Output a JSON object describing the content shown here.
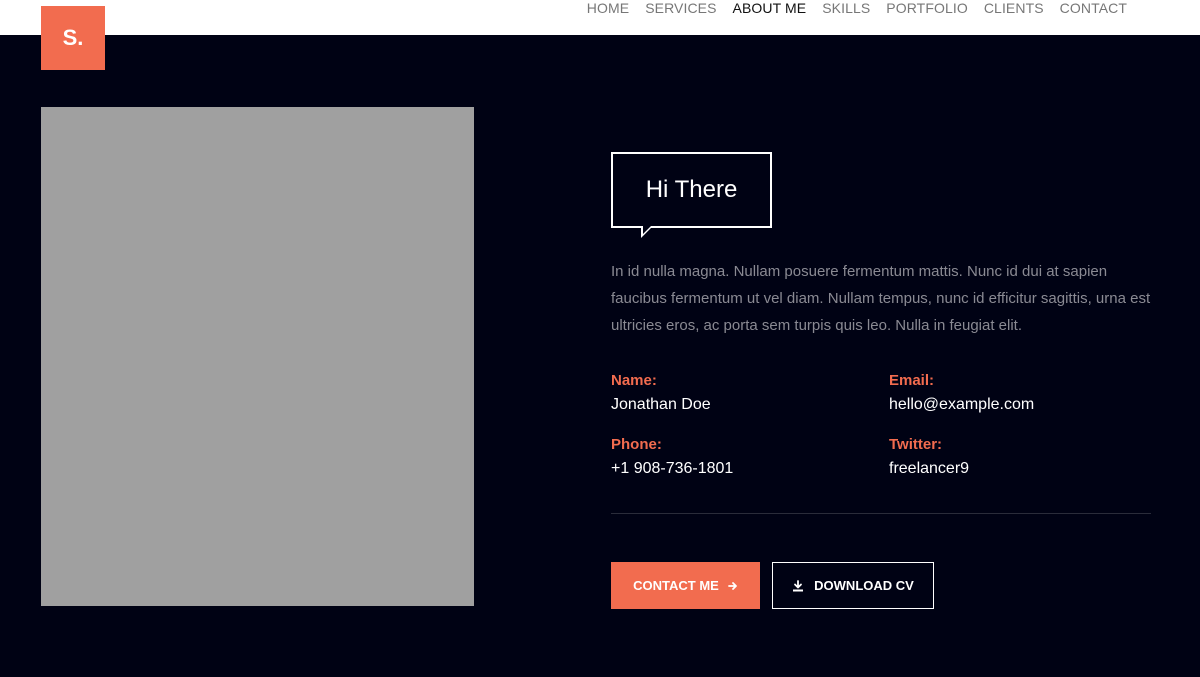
{
  "logo": {
    "text": "S."
  },
  "nav": {
    "items": [
      "HOME",
      "SERVICES",
      "ABOUT ME",
      "SKILLS",
      "PORTFOLIO",
      "CLIENTS",
      "CONTACT"
    ],
    "active": "ABOUT ME"
  },
  "about": {
    "heading": "Hi There",
    "intro": "In id nulla magna. Nullam posuere fermentum mattis. Nunc id dui at sapien faucibus fermentum ut vel diam. Nullam tempus, nunc id efficitur sagittis, urna est ultricies eros, ac porta sem turpis quis leo. Nulla in feugiat elit.",
    "info": {
      "name_label": "Name:",
      "name_value": "Jonathan Doe",
      "email_label": "Email:",
      "email_value": "hello@example.com",
      "phone_label": "Phone:",
      "phone_value": "+1 908-736-1801",
      "twitter_label": "Twitter:",
      "twitter_value": "freelancer9"
    },
    "buttons": {
      "contact_label": "CONTACT ME",
      "contact_icon": "arrow-right-icon",
      "cv_label": "DOWNLOAD CV",
      "cv_icon": "download-icon"
    }
  },
  "colors": {
    "accent": "#f26c4f",
    "background": "#000214",
    "photo_placeholder": "#a0a0a0"
  }
}
